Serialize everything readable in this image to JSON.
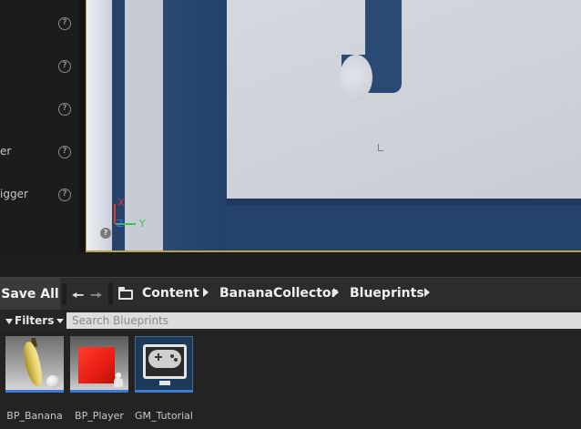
{
  "details_panel": {
    "rows": [
      {
        "label": "",
        "help": "?"
      },
      {
        "label": "",
        "help": "?"
      },
      {
        "label": "",
        "help": "?"
      },
      {
        "label": "er",
        "help": "?"
      },
      {
        "label": "igger",
        "help": "?"
      }
    ]
  },
  "viewport": {
    "axis": {
      "x": "X",
      "y": "Y",
      "z": "Z"
    },
    "help": "?"
  },
  "toolbar": {
    "save_all_label": "Save All",
    "breadcrumbs": [
      "Content",
      "BananaCollector",
      "Blueprints"
    ]
  },
  "filterbar": {
    "filters_label": "Filters",
    "search_placeholder": "Search Blueprints"
  },
  "assets": [
    {
      "name": "BP_Banana",
      "icon": "banana-thumbnail"
    },
    {
      "name": "BP_Player",
      "icon": "red-cube-thumbnail"
    },
    {
      "name": "GM_Tutorial",
      "icon": "game-mode-thumbnail"
    }
  ],
  "colors": {
    "selection_underline": "#3c7ad8",
    "viewport_border": "#b7a14a",
    "axis_x": "#e0362f",
    "axis_y": "#3cc24a",
    "axis_z": "#3a7bff"
  }
}
